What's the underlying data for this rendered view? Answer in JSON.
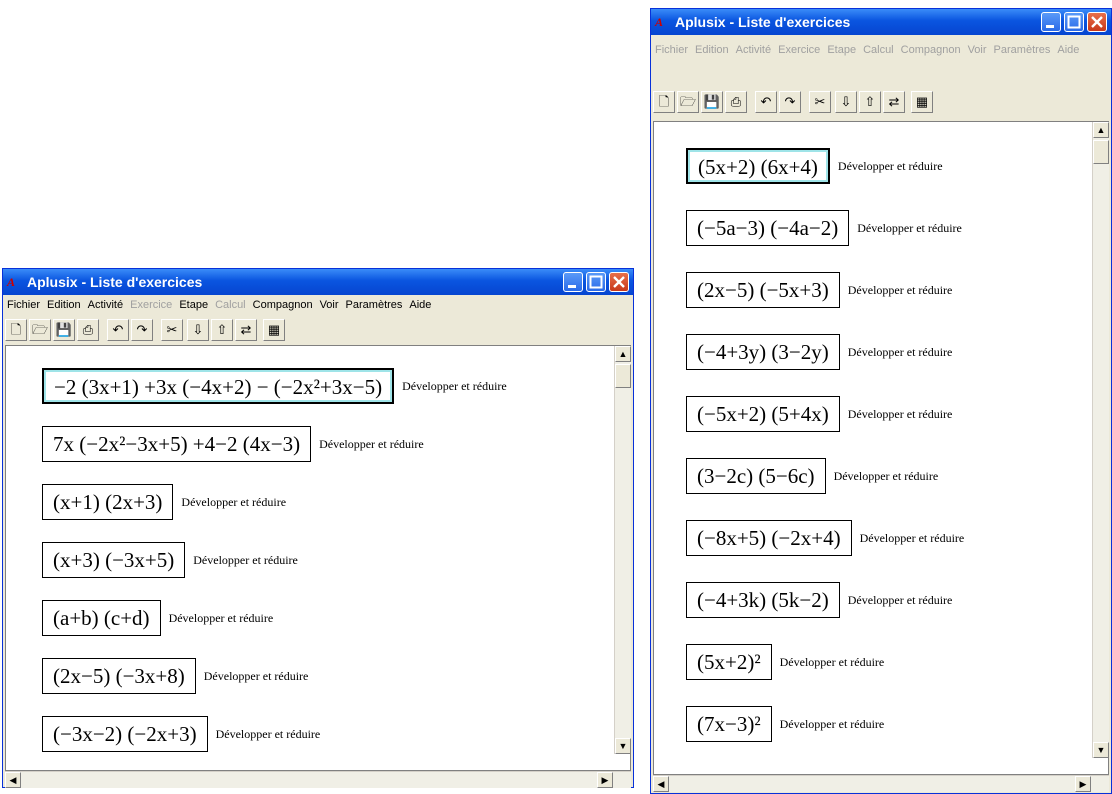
{
  "windows": [
    {
      "id": "left",
      "title": "Aplusix - Liste d'exercices",
      "menu": [
        {
          "label": "Fichier",
          "enabled": true
        },
        {
          "label": "Edition",
          "enabled": true
        },
        {
          "label": "Activité",
          "enabled": true
        },
        {
          "label": "Exercice",
          "enabled": false
        },
        {
          "label": "Etape",
          "enabled": true
        },
        {
          "label": "Calcul",
          "enabled": false
        },
        {
          "label": "Compagnon",
          "enabled": true
        },
        {
          "label": "Voir",
          "enabled": true
        },
        {
          "label": "Paramètres",
          "enabled": true
        },
        {
          "label": "Aide",
          "enabled": true
        }
      ],
      "exercises": [
        {
          "expr": "−2 (3x+1) +3x (−4x+2) − (−2x²+3x−5)",
          "label": "Développer et réduire",
          "selected": true
        },
        {
          "expr": "7x (−2x²−3x+5) +4−2 (4x−3)",
          "label": "Développer et réduire",
          "selected": false
        },
        {
          "expr": "(x+1) (2x+3)",
          "label": "Développer et réduire",
          "selected": false
        },
        {
          "expr": "(x+3) (−3x+5)",
          "label": "Développer et réduire",
          "selected": false
        },
        {
          "expr": "(a+b) (c+d)",
          "label": "Développer et réduire",
          "selected": false
        },
        {
          "expr": "(2x−5) (−3x+8)",
          "label": "Développer et réduire",
          "selected": false
        },
        {
          "expr": "(−3x−2) (−2x+3)",
          "label": "Développer et réduire",
          "selected": false
        }
      ]
    },
    {
      "id": "right",
      "title": "Aplusix - Liste d'exercices",
      "menu": [
        {
          "label": "Fichier",
          "enabled": false
        },
        {
          "label": "Edition",
          "enabled": false
        },
        {
          "label": "Activité",
          "enabled": false
        },
        {
          "label": "Exercice",
          "enabled": false
        },
        {
          "label": "Etape",
          "enabled": false
        },
        {
          "label": "Calcul",
          "enabled": false
        },
        {
          "label": "Compagnon",
          "enabled": false
        },
        {
          "label": "Voir",
          "enabled": false
        },
        {
          "label": "Paramètres",
          "enabled": false
        },
        {
          "label": "Aide",
          "enabled": false
        }
      ],
      "exercises": [
        {
          "expr": "(5x+2) (6x+4)",
          "label": "Développer et réduire",
          "selected": true
        },
        {
          "expr": "(−5a−3) (−4a−2)",
          "label": "Développer et réduire",
          "selected": false
        },
        {
          "expr": "(2x−5) (−5x+3)",
          "label": "Développer et réduire",
          "selected": false
        },
        {
          "expr": "(−4+3y) (3−2y)",
          "label": "Développer et réduire",
          "selected": false
        },
        {
          "expr": "(−5x+2) (5+4x)",
          "label": "Développer et réduire",
          "selected": false
        },
        {
          "expr": "(3−2c) (5−6c)",
          "label": "Développer et réduire",
          "selected": false
        },
        {
          "expr": "(−8x+5) (−2x+4)",
          "label": "Développer et réduire",
          "selected": false
        },
        {
          "expr": "(−4+3k) (5k−2)",
          "label": "Développer et réduire",
          "selected": false
        },
        {
          "expr": "(5x+2)²",
          "label": "Développer et réduire",
          "selected": false
        },
        {
          "expr": "(7x−3)²",
          "label": "Développer et réduire",
          "selected": false
        }
      ]
    }
  ],
  "icons": [
    "new-file-icon",
    "open-folder-icon",
    "save-icon",
    "print-icon",
    "undo-icon",
    "redo-icon",
    "scissors-icon",
    "import-icon",
    "export-icon",
    "transfer-icon",
    "calculator-icon"
  ]
}
